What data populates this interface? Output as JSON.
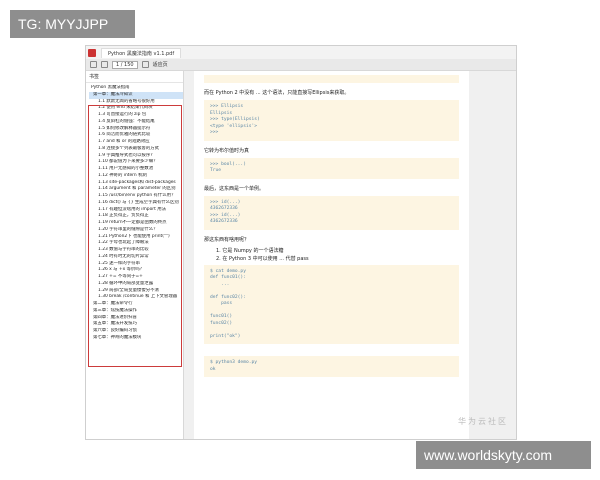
{
  "watermark_tag": "TG: MYYJJPP",
  "site_watermark": "www.worldskyty.com",
  "window": {
    "title": "Python 黑魔法指南 v1.1.pdf",
    "page_indicator": "1 / 150",
    "zoom": "适应页"
  },
  "sidebar": {
    "title": "书签",
    "items": [
      {
        "label": "Python 黑魔法指南",
        "level": "root"
      },
      {
        "label": "第一章：魔法冷知识",
        "level": "chapter",
        "active": true
      },
      {
        "label": "1.1 默默无闻的省略号很好用",
        "level": "section"
      },
      {
        "label": "1.2 使用 end 来结束代码块",
        "level": "section"
      },
      {
        "label": "1.3 可直接运行的 zip 包",
        "level": "section"
      },
      {
        "label": "1.4 反斜杠的倔强：不能结尾",
        "level": "section"
      },
      {
        "label": "1.5 如何修改解释器提示符",
        "level": "section"
      },
      {
        "label": "1.6 简洁而优雅的链式比较",
        "level": "section"
      },
      {
        "label": "1.7 and 和 or 的短路效应",
        "level": "section"
      },
      {
        "label": "1.8 连接多个列表最极客的方式",
        "level": "section"
      },
      {
        "label": "1.9 字典推导式也可以按序?",
        "level": "section"
      },
      {
        "label": "1.10 都说值为下来要多少嘛？",
        "level": "section"
      },
      {
        "label": "1.11 用户无感知的小整数池",
        "level": "section"
      },
      {
        "label": "1.12 神奇的 intern 机制",
        "level": "section"
      },
      {
        "label": "1.13 site-packages和 dist-packages",
        "level": "section"
      },
      {
        "label": "1.14 argument 和 parameter 的区别",
        "level": "section"
      },
      {
        "label": "1.15 /usr/bin/env python 有什么用？",
        "level": "section"
      },
      {
        "label": "1.16 dict() 与 {} 生成空字典有什么区别",
        "level": "section"
      },
      {
        "label": "1.17 有趣但没啥用的 import 用法",
        "level": "section"
      },
      {
        "label": "1.18 正负得正，负负得正",
        "level": "section"
      },
      {
        "label": "1.19 return不一定都是函数的终点",
        "level": "section"
      },
      {
        "label": "1.20 字符串里的缝隙是什么？",
        "level": "section"
      },
      {
        "label": "1.21 Python2下 也能使用 print(\"\")",
        "level": "section"
      },
      {
        "label": "1.22 字母也玩起了障眼法",
        "level": "section"
      },
      {
        "label": "1.23 数值与字符串的比较",
        "level": "section"
      },
      {
        "label": "1.24 时有时无的切片异常",
        "level": "section"
      },
      {
        "label": "1.25 迷一样的字符串",
        "level": "section"
      },
      {
        "label": "1.26 x 与 +x 等价吗？",
        "level": "section"
      },
      {
        "label": "1.27 += 不等同于=+",
        "level": "section"
      },
      {
        "label": "1.28 循环中的局部变量泄露",
        "level": "section"
      },
      {
        "label": "1.29 局部/全局变量傻傻分不清",
        "level": "section"
      },
      {
        "label": "1.30 break /continue 和 上下文管理器",
        "level": "section"
      },
      {
        "label": "第二章：魔法命令行",
        "level": "chapter"
      },
      {
        "label": "第三章：炫技魔法操作",
        "level": "chapter"
      },
      {
        "label": "第四章：魔法进阶扫盲",
        "level": "chapter"
      },
      {
        "label": "第五章：魔法开发技巧",
        "level": "chapter"
      },
      {
        "label": "第六章：良好编码习惯",
        "level": "chapter"
      },
      {
        "label": "第七章：神奇的魔法模块",
        "level": "chapter"
      }
    ]
  },
  "content": {
    "para1": "而在 Python 2 中没有 ... 这个语法，只能直接写Ellipsis来获取。",
    "code1": ">>> Ellipsis\nEllipsis\n>>> type(Ellipsis)\n<type 'ellipsis'>\n>>>",
    "para2": "它转为布尔值时为真",
    "code2": ">>> bool(...)\nTrue",
    "para3": "最后，这东西是一个单例。",
    "code3": ">>> id(...)\n4362672336\n>>> id(...)\n4362672336",
    "para4": "那这东西有啥用呢？",
    "list": [
      "1.  它是 Numpy 的一个语法糖",
      "2.  在 Python 3 中可以使用 ... 代替 pass"
    ],
    "code4": "$ cat demo.py\ndef func01():\n    ...\n\ndef func02():\n    pass\n\nfunc01()\nfunc02()\n\nprint(\"ok\")",
    "code5": "$ python3 demo.py\nok",
    "brand": "华为云社区"
  }
}
